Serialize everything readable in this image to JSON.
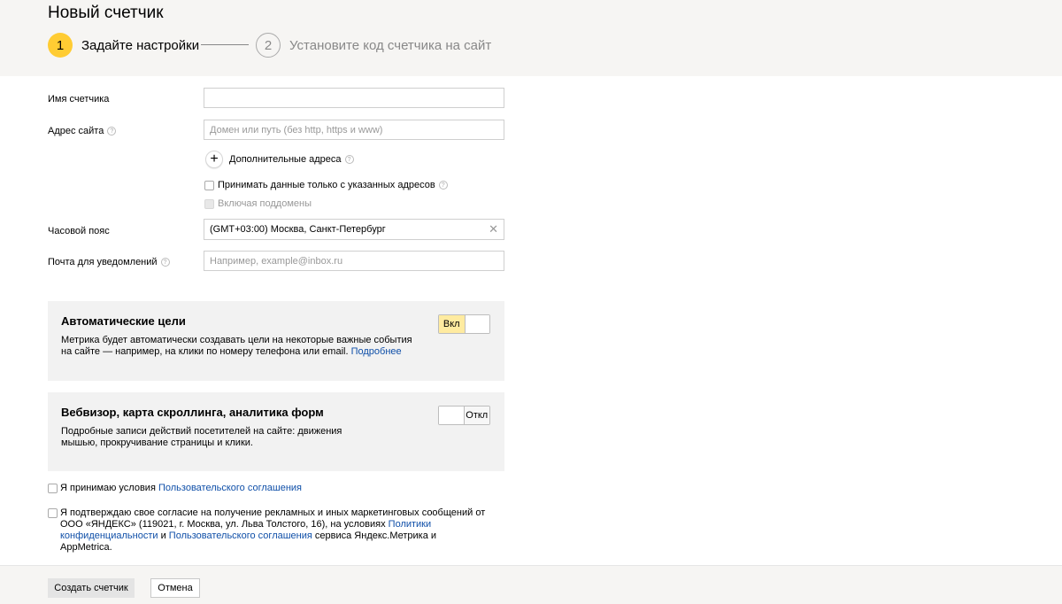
{
  "header": {
    "title": "Новый счетчик",
    "steps": [
      {
        "number": "1",
        "label": "Задайте настройки"
      },
      {
        "number": "2",
        "label": "Установите код счетчика на сайт"
      }
    ]
  },
  "form": {
    "counter_name_label": "Имя счетчика",
    "counter_name_value": "",
    "site_address_label": "Адрес сайта",
    "site_address_placeholder": "Домен или путь (без http, https и www)",
    "additional_addresses_label": "Дополнительные адреса",
    "only_specified_label": "Принимать данные только с указанных адресов",
    "include_subdomains_label": "Включая поддомены",
    "timezone_label": "Часовой пояс",
    "timezone_value": "(GMT+03:00) Москва, Санкт-Петербург",
    "email_label": "Почта для уведомлений",
    "email_placeholder": "Например, example@inbox.ru",
    "help_glyph": "?",
    "plus_glyph": "+",
    "clear_glyph": "✕"
  },
  "auto_goals": {
    "title": "Автоматические цели",
    "description": "Метрика будет автоматически создавать цели на некоторые важные события на сайте — например, на клики по номеру телефона или email.",
    "link": "Подробнее",
    "toggle_label": "Вкл",
    "enabled": true
  },
  "webvisor": {
    "title": "Вебвизор, карта скроллинга, аналитика форм",
    "description": "Подробные записи действий посетителей на сайте: движения мышью, прокручивание страницы и клики.",
    "toggle_label": "Откл",
    "enabled": false
  },
  "consents": {
    "terms_prefix": "Я принимаю условия ",
    "terms_link": "Пользовательского соглашения",
    "marketing_prefix": "Я подтверждаю свое согласие на получение рекламных и иных маркетинговых сообщений от ООО «ЯНДЕКС» (119021, г. Москва, ул. Льва Толстого, 16), на условиях ",
    "privacy_link": "Политики конфиденциальности",
    "and": " и ",
    "user_agreement_link": "Пользовательского соглашения",
    "marketing_suffix": " сервиса Яндекс.Метрика и AppMetrica."
  },
  "footer": {
    "create_label": "Создать счетчик",
    "cancel_label": "Отмена"
  },
  "colors": {
    "accent_yellow": "#ffcc33",
    "toggle_on": "#ffeba0",
    "link": "#0f4fa8",
    "panel_bg": "#f2f2f2",
    "header_bg": "#f6f5f3"
  }
}
